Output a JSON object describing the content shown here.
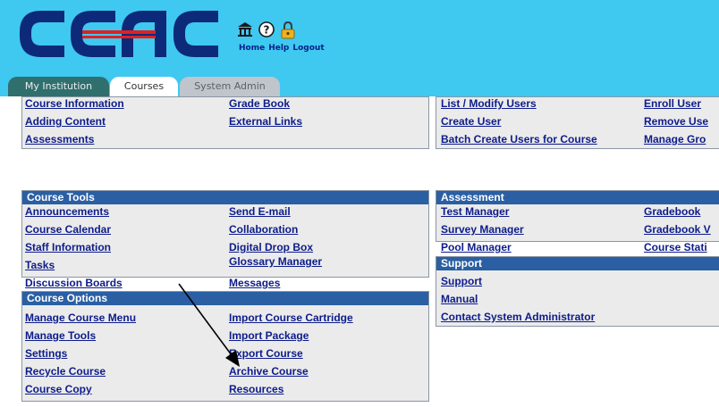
{
  "header": {
    "logo_text": "CCAC",
    "links": {
      "home": "Home",
      "help": "Help",
      "logout": "Logout"
    },
    "colors": {
      "background": "#3FC8F0",
      "logo_navy": "#0D2A7A",
      "logo_red": "#E02020"
    }
  },
  "tabs": {
    "institution": "My Institution",
    "courses": "Courses",
    "system_admin": "System Admin"
  },
  "panels": {
    "top_left": {
      "col1": [
        "Course Information",
        "Adding Content",
        "Assessments"
      ],
      "col2": [
        "Grade Book",
        "External Links"
      ]
    },
    "top_right": {
      "col1": [
        "List / Modify Users",
        "Create User",
        "Batch Create Users for Course"
      ],
      "col2": [
        "Enroll User",
        "Remove Use",
        "Manage Gro"
      ]
    },
    "course_tools": {
      "title": "Course Tools",
      "col1": [
        "Announcements",
        "Course Calendar",
        "Staff Information",
        "Tasks",
        "Discussion Boards"
      ],
      "col2": [
        "Send E-mail",
        "Collaboration",
        "Digital Drop Box",
        "Glossary Manager",
        "Messages"
      ]
    },
    "assessment": {
      "title": "Assessment",
      "col1": [
        "Test Manager",
        "Survey Manager",
        "Pool Manager"
      ],
      "col2": [
        "Gradebook",
        "Gradebook V",
        "Course Stati"
      ]
    },
    "support": {
      "title": "Support",
      "links": [
        "Support",
        "Manual",
        "Contact System Administrator"
      ]
    },
    "course_options": {
      "title": "Course Options",
      "col1": [
        "Manage Course Menu",
        "Manage Tools",
        "Settings",
        "Recycle Course",
        "Course Copy"
      ],
      "col2": [
        "Import Course Cartridge",
        "Import Package",
        "Export Course",
        "Archive Course",
        "Resources"
      ]
    }
  },
  "theme": {
    "panel_header": "#2A5FA3",
    "panel_bg": "#EBEBEB",
    "link": "#0D1C8A"
  }
}
